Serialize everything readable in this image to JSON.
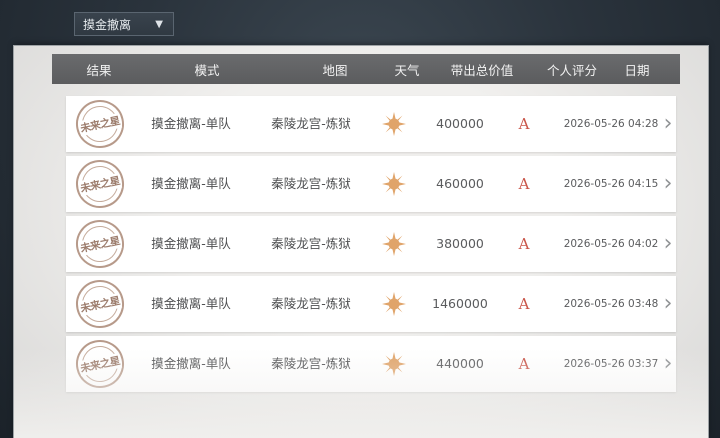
{
  "mode_dropdown": {
    "label": "摸金撤离"
  },
  "table": {
    "headers": {
      "result": "结果",
      "mode": "模式",
      "map": "地图",
      "weather": "天气",
      "value": "带出总价值",
      "rating": "个人评分",
      "date": "日期"
    },
    "rows": [
      {
        "stamp": "未来之星",
        "mode": "摸金撤离-单队",
        "map": "秦陵龙宫-炼狱",
        "weather_icon": "sun-icon",
        "value": "400000",
        "rating": "A",
        "date": "2026-05-26 04:28"
      },
      {
        "stamp": "未来之星",
        "mode": "摸金撤离-单队",
        "map": "秦陵龙宫-炼狱",
        "weather_icon": "sun-icon",
        "value": "460000",
        "rating": "A",
        "date": "2026-05-26 04:15"
      },
      {
        "stamp": "未来之星",
        "mode": "摸金撤离-单队",
        "map": "秦陵龙宫-炼狱",
        "weather_icon": "sun-icon",
        "value": "380000",
        "rating": "A",
        "date": "2026-05-26 04:02"
      },
      {
        "stamp": "未来之星",
        "mode": "摸金撤离-单队",
        "map": "秦陵龙宫-炼狱",
        "weather_icon": "sun-icon",
        "value": "1460000",
        "rating": "A",
        "date": "2026-05-26 03:48"
      },
      {
        "stamp": "未来之星",
        "mode": "摸金撤离-单队",
        "map": "秦陵龙宫-炼狱",
        "weather_icon": "sun-icon",
        "value": "440000",
        "rating": "A",
        "date": "2026-05-26 03:37"
      }
    ]
  },
  "colors": {
    "rating": "#c9564a",
    "sun": "#e0a46a",
    "stamp": "#b79a8a"
  }
}
